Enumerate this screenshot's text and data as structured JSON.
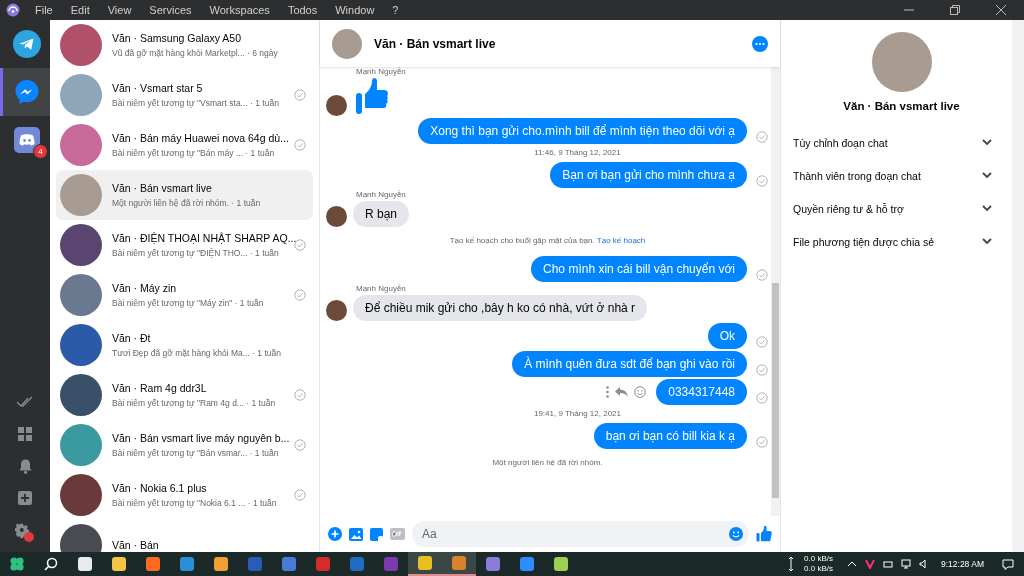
{
  "menu": {
    "items": [
      "File",
      "Edit",
      "View",
      "Services",
      "Workspaces",
      "Todos",
      "Window",
      "?"
    ]
  },
  "services": [
    {
      "kind": "telegram",
      "selected": false
    },
    {
      "kind": "messenger",
      "selected": true
    },
    {
      "kind": "discord",
      "selected": false,
      "badge": "4"
    }
  ],
  "conversations": [
    {
      "title": "Văn · Samsung Galaxy A50",
      "preview": "Vũ đã gỡ mặt hàng khỏi Marketpl...",
      "time": "· 6 ngày",
      "selected": false,
      "seen": false,
      "color": "#b0506a"
    },
    {
      "title": "Văn · Vsmart star 5",
      "preview": "Bài niêm yết tương tự \"Vsmart sta...",
      "time": "· 1 tuần",
      "selected": false,
      "seen": true,
      "color": "#8fa6b8"
    },
    {
      "title": "Văn · Bán máy Huawei nova 64g dù...",
      "preview": "Bài niêm yết tương tự \"Bán máy ...",
      "time": "· 1 tuần",
      "selected": false,
      "seen": true,
      "color": "#c86a9a"
    },
    {
      "title": "Văn · Bán vsmart live",
      "preview": "Một người liên hệ đã rời nhóm.",
      "time": "· 1 tuần",
      "selected": true,
      "seen": false,
      "color": "#a89c92"
    },
    {
      "title": "Văn · ĐIỆN THOẠI NHẬT SHARP AQ...",
      "preview": "Bài niêm yết tương tự \"ĐIỆN THO...",
      "time": "· 1 tuần",
      "selected": false,
      "seen": true,
      "color": "#5a4470"
    },
    {
      "title": "Văn · Máy zin",
      "preview": "Bài niêm yết tương tự \"Máy zin\"",
      "time": "· 1 tuần",
      "selected": false,
      "seen": true,
      "color": "#6a7890"
    },
    {
      "title": "Văn · Đt",
      "preview": "Tươi Đẹp đã gỡ mặt hàng khỏi Ma...",
      "time": "· 1 tuần",
      "selected": false,
      "seen": false,
      "color": "#2a5aa8"
    },
    {
      "title": "Văn · Ram 4g ddr3L",
      "preview": "Bài niêm yết tương tự \"Ram 4g d...",
      "time": "· 1 tuần",
      "selected": false,
      "seen": true,
      "color": "#3a5068"
    },
    {
      "title": "Văn · Bán vsmart live máy nguyên b...",
      "preview": "Bài niêm yết tương tự \"Bán vsmar...",
      "time": "· 1 tuần",
      "selected": false,
      "seen": true,
      "color": "#3a9aa0"
    },
    {
      "title": "Văn · Nokia 6.1 plus",
      "preview": "Bài niêm yết tương tự \"Nokia 6.1 ...",
      "time": "· 1 tuần",
      "selected": false,
      "seen": true,
      "color": "#6a3a3a"
    },
    {
      "title": "Văn · Bán",
      "selected": false,
      "seen": false,
      "color": "#4a4a52"
    }
  ],
  "chat": {
    "title": "Văn · Bán vsmart live",
    "messages": [
      {
        "kind": "sender",
        "text": "Mạnh Nguyễn"
      },
      {
        "kind": "like"
      },
      {
        "kind": "outgoing",
        "text": "Xong thì bạn gửi cho.mình bill để mình tiện theo dõi với ạ"
      },
      {
        "kind": "timestamp",
        "text": "11:46, 9 Tháng 12, 2021"
      },
      {
        "kind": "outgoing",
        "text": "Bạn ơi bạn gửi cho mình chưa ạ"
      },
      {
        "kind": "sender",
        "text": "Mạnh Nguyễn"
      },
      {
        "kind": "incoming",
        "text": "R bạn"
      },
      {
        "kind": "system",
        "text": "Tạo kế hoạch cho buổi gặp mặt của bạn.",
        "link": "Tạo kế hoạch"
      },
      {
        "kind": "outgoing",
        "text": "Cho mình xin cái bill vận chuyển với"
      },
      {
        "kind": "sender",
        "text": "Mạnh Nguyễn"
      },
      {
        "kind": "incoming",
        "text": "Để chiều mik gửi cho ,bây h ko có nhà, vứt ở nhà r"
      },
      {
        "kind": "outgoing",
        "text": "Ok"
      },
      {
        "kind": "outgoing",
        "text": "À mình quên đưa sdt để bạn ghi vào rồi"
      },
      {
        "kind": "outgoing",
        "text": "0334317448",
        "hover_actions": true
      },
      {
        "kind": "timestamp",
        "text": "19:41, 9 Tháng 12, 2021"
      },
      {
        "kind": "outgoing",
        "text": "bạn ơi bạn có bill kia k ạ"
      },
      {
        "kind": "system",
        "text": "Một người liên hệ đã rời nhóm."
      }
    ],
    "composer": {
      "placeholder": "Aa"
    }
  },
  "info": {
    "title": "Văn · Bán vsmart live",
    "sections": [
      {
        "label": "Tùy chỉnh đoạn chat",
        "expanded": false
      },
      {
        "label": "Thành viên trong đoạn chat",
        "expanded": false
      },
      {
        "label": "Quyền riêng tư & hỗ trợ",
        "expanded": false
      },
      {
        "label": "File phương tiện được chia sẻ",
        "expanded": false
      }
    ]
  },
  "taskbar": {
    "net_up": "0.0 kB/s",
    "net_down": "0.0 kB/s",
    "clock": "9:12:28 AM"
  }
}
